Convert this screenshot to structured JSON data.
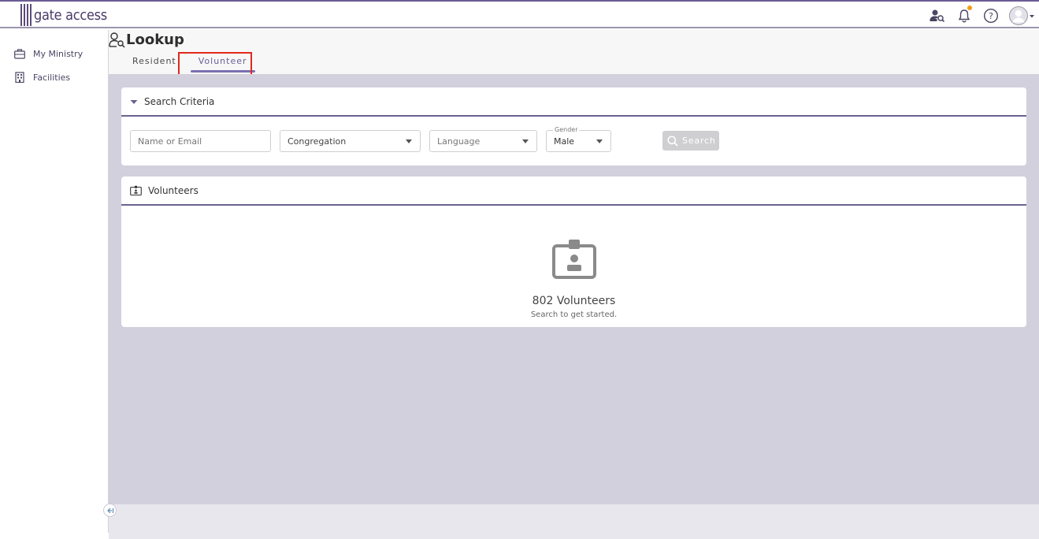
{
  "app": {
    "logo_text": "gate access"
  },
  "sidebar": {
    "items": [
      {
        "label": "My Ministry",
        "icon": "briefcase-icon"
      },
      {
        "label": "Facilities",
        "icon": "building-icon"
      }
    ]
  },
  "page": {
    "title": "Lookup",
    "tabs": [
      {
        "label": "Resident",
        "active": false
      },
      {
        "label": "Volunteer",
        "active": true
      }
    ]
  },
  "search_criteria": {
    "title": "Search Criteria",
    "name_placeholder": "Name or Email",
    "congregation_value": "Congregation",
    "language_value": "Language",
    "gender_label": "Gender",
    "gender_value": "Male",
    "search_label": "Search"
  },
  "volunteers": {
    "title": "Volunteers",
    "count_text": "802 Volunteers",
    "hint": "Search to get started."
  },
  "colors": {
    "accent": "#6b6290",
    "tab_active": "#7a6fb0",
    "highlight": "#e0281c",
    "notification": "#f39c12"
  }
}
